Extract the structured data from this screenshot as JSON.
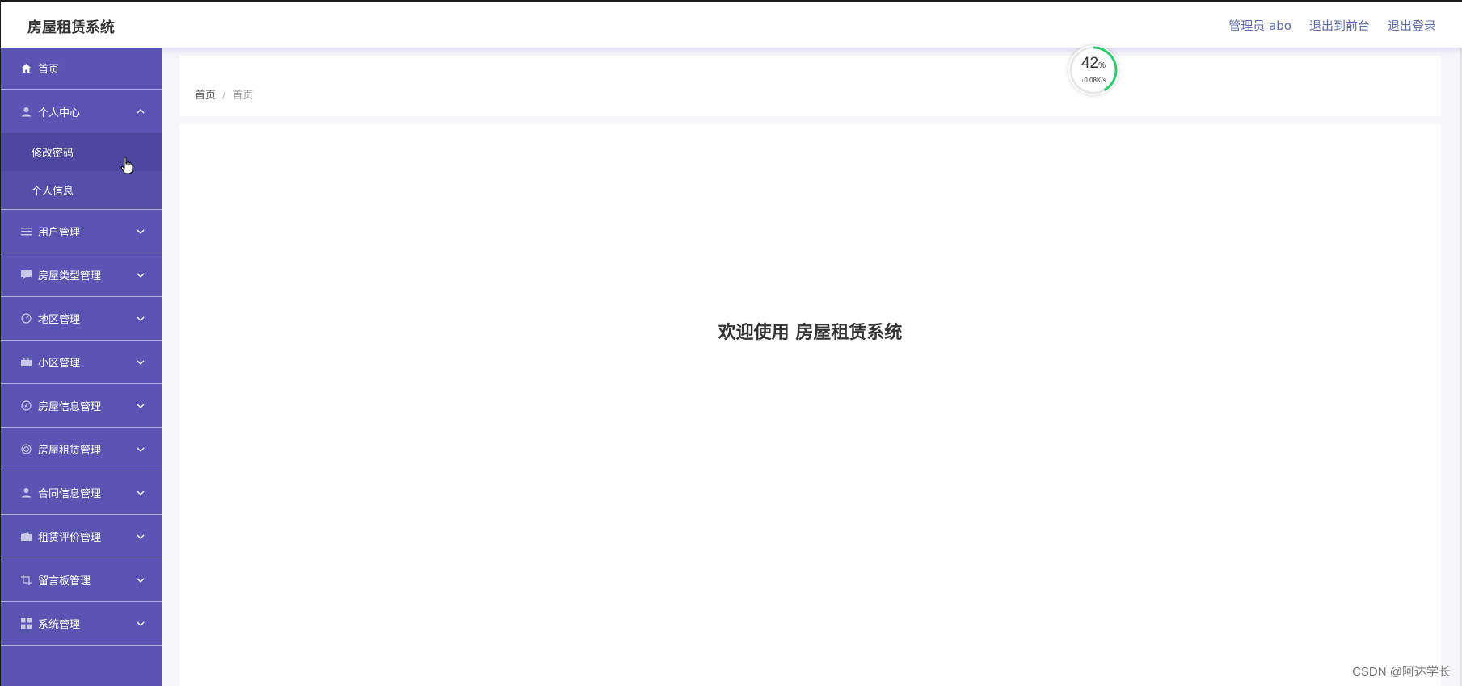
{
  "app": {
    "title": "房屋租赁系统"
  },
  "header": {
    "admin_label": "管理员 abo",
    "to_frontend": "退出到前台",
    "logout": "退出登录"
  },
  "sidebar": {
    "home": "首页",
    "personal_center": {
      "label": "个人中心",
      "expanded": true,
      "children": [
        "修改密码",
        "个人信息"
      ]
    },
    "groups": [
      {
        "label": "用户管理",
        "icon": "list-icon"
      },
      {
        "label": "房屋类型管理",
        "icon": "chat-icon"
      },
      {
        "label": "地区管理",
        "icon": "gauge-icon"
      },
      {
        "label": "小区管理",
        "icon": "briefcase-icon"
      },
      {
        "label": "房屋信息管理",
        "icon": "compass-icon"
      },
      {
        "label": "房屋租赁管理",
        "icon": "target-icon"
      },
      {
        "label": "合同信息管理",
        "icon": "user-icon"
      },
      {
        "label": "租赁评价管理",
        "icon": "wallet-icon"
      },
      {
        "label": "留言板管理",
        "icon": "crop-icon"
      },
      {
        "label": "系统管理",
        "icon": "grid-icon"
      }
    ]
  },
  "breadcrumb": {
    "root": "首页",
    "separator": "/",
    "current": "首页"
  },
  "main": {
    "welcome": "欢迎使用 房屋租赁系统"
  },
  "network_widget": {
    "percent": "42",
    "percent_unit": "%",
    "speed": "↓0.08K/s",
    "progress": 0.42
  },
  "watermark": "CSDN @阿达学长",
  "colors": {
    "sidebar_bg": "#5a55b3",
    "accent_text": "#5e6aa8",
    "ring": "#2ecc71"
  }
}
